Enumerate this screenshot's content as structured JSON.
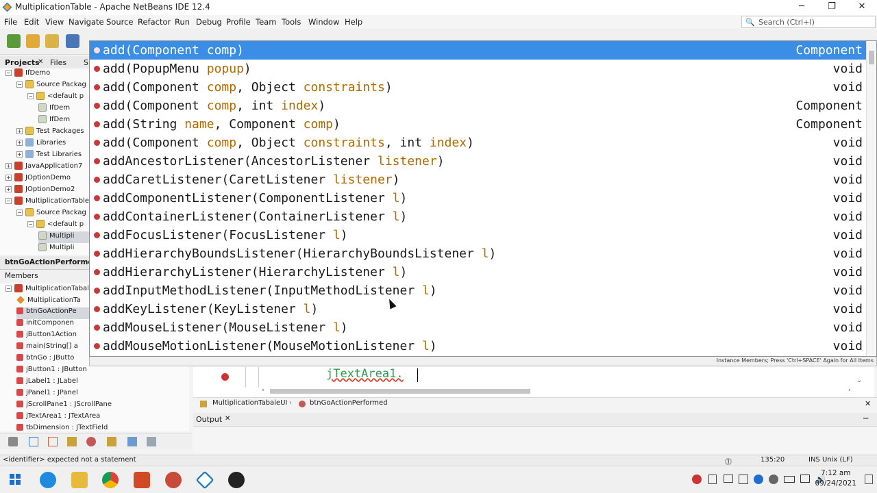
{
  "window": {
    "title": "MultiplicationTable - Apache NetBeans IDE 12.4"
  },
  "menus": [
    "File",
    "Edit",
    "View",
    "Navigate",
    "Source",
    "Refactor",
    "Run",
    "Debug",
    "Profile",
    "Team",
    "Tools",
    "Window",
    "Help"
  ],
  "search": {
    "placeholder": "Search (Ctrl+I)"
  },
  "projects_panel": {
    "tabs": [
      "Projects",
      "Files",
      "S"
    ],
    "tree": [
      {
        "label": "IfDemo",
        "indent": 0,
        "icon": "cup",
        "expanded": true
      },
      {
        "label": "Source Packag",
        "indent": 1,
        "icon": "pkg",
        "expanded": true
      },
      {
        "label": "<default p",
        "indent": 2,
        "icon": "pkg",
        "expanded": true
      },
      {
        "label": "IfDem",
        "indent": 3,
        "icon": "jav"
      },
      {
        "label": "IfDem",
        "indent": 3,
        "icon": "jav"
      },
      {
        "label": "Test Packages",
        "indent": 1,
        "icon": "pkg",
        "expanded": false
      },
      {
        "label": "Libraries",
        "indent": 1,
        "icon": "fold",
        "expanded": false
      },
      {
        "label": "Test Libraries",
        "indent": 1,
        "icon": "fold",
        "expanded": false
      },
      {
        "label": "JavaApplication7",
        "indent": 0,
        "icon": "cup",
        "expanded": false
      },
      {
        "label": "JOptionDemo",
        "indent": 0,
        "icon": "cup",
        "expanded": false
      },
      {
        "label": "JOptionDemo2",
        "indent": 0,
        "icon": "cup",
        "expanded": false
      },
      {
        "label": "MultiplicationTable",
        "indent": 0,
        "icon": "cup",
        "expanded": true
      },
      {
        "label": "Source Packag",
        "indent": 1,
        "icon": "pkg",
        "expanded": true
      },
      {
        "label": "<default p",
        "indent": 2,
        "icon": "pkg",
        "expanded": true
      },
      {
        "label": "Multipli",
        "indent": 3,
        "icon": "jav",
        "selected": true
      },
      {
        "label": "Multipli",
        "indent": 3,
        "icon": "jav"
      }
    ]
  },
  "navigator": {
    "title": "btnGoActionPerformed",
    "filter": "Members",
    "items": [
      {
        "label": "MultiplicationTabale",
        "indent": 0,
        "icon": "cup",
        "expanded": true
      },
      {
        "label": "MultiplicationTa",
        "indent": 1,
        "icon": "f"
      },
      {
        "label": "btnGoActionPe",
        "indent": 1,
        "icon": "m",
        "selected": true
      },
      {
        "label": "initComponen",
        "indent": 1,
        "icon": "m"
      },
      {
        "label": "jButton1Action",
        "indent": 1,
        "icon": "m"
      },
      {
        "label": "main(String[] a",
        "indent": 1,
        "icon": "m"
      },
      {
        "label": "btnGo : JButto",
        "indent": 1,
        "icon": "m"
      },
      {
        "label": "jButton1 : JButton",
        "indent": 1,
        "icon": "m"
      },
      {
        "label": "jLabel1 : JLabel",
        "indent": 1,
        "icon": "m"
      },
      {
        "label": "jPanel1 : JPanel",
        "indent": 1,
        "icon": "m"
      },
      {
        "label": "jScrollPane1 : JScrollPane",
        "indent": 1,
        "icon": "m"
      },
      {
        "label": "jTextArea1 : JTextArea",
        "indent": 1,
        "icon": "m"
      },
      {
        "label": "tbDimension : JTextField",
        "indent": 1,
        "icon": "m"
      }
    ]
  },
  "completion": {
    "items": [
      {
        "name": "add(",
        "params": [
          [
            "Component ",
            "comp"
          ]
        ],
        "close": ")",
        "ret": "Component"
      },
      {
        "name": "add(",
        "params": [
          [
            "PopupMenu ",
            "popup"
          ]
        ],
        "close": ")",
        "ret": "void"
      },
      {
        "name": "add(",
        "params": [
          [
            "Component ",
            "comp"
          ],
          [
            "Object ",
            "constraints"
          ]
        ],
        "close": ")",
        "ret": "void"
      },
      {
        "name": "add(",
        "params": [
          [
            "Component ",
            "comp"
          ],
          [
            "int ",
            "index"
          ]
        ],
        "close": ")",
        "ret": "Component"
      },
      {
        "name": "add(",
        "params": [
          [
            "String ",
            "name"
          ],
          [
            "Component ",
            "comp"
          ]
        ],
        "close": ")",
        "ret": "Component"
      },
      {
        "name": "add(",
        "params": [
          [
            "Component ",
            "comp"
          ],
          [
            "Object ",
            "constraints"
          ],
          [
            "int ",
            "index"
          ]
        ],
        "close": ")",
        "ret": "void"
      },
      {
        "name": "addAncestorListener(",
        "params": [
          [
            "AncestorListener ",
            "listener"
          ]
        ],
        "close": ")",
        "ret": "void"
      },
      {
        "name": "addCaretListener(",
        "params": [
          [
            "CaretListener ",
            "listener"
          ]
        ],
        "close": ")",
        "ret": "void"
      },
      {
        "name": "addComponentListener(",
        "params": [
          [
            "ComponentListener ",
            "l"
          ]
        ],
        "close": ")",
        "ret": "void"
      },
      {
        "name": "addContainerListener(",
        "params": [
          [
            "ContainerListener ",
            "l"
          ]
        ],
        "close": ")",
        "ret": "void"
      },
      {
        "name": "addFocusListener(",
        "params": [
          [
            "FocusListener ",
            "l"
          ]
        ],
        "close": ")",
        "ret": "void"
      },
      {
        "name": "addHierarchyBoundsListener(",
        "params": [
          [
            "HierarchyBoundsListener ",
            "l"
          ]
        ],
        "close": ")",
        "ret": "void"
      },
      {
        "name": "addHierarchyListener(",
        "params": [
          [
            "HierarchyListener ",
            "l"
          ]
        ],
        "close": ")",
        "ret": "void"
      },
      {
        "name": "addInputMethodListener(",
        "params": [
          [
            "InputMethodListener ",
            "l"
          ]
        ],
        "close": ")",
        "ret": "void"
      },
      {
        "name": "addKeyListener(",
        "params": [
          [
            "KeyListener ",
            "l"
          ]
        ],
        "close": ")",
        "ret": "void"
      },
      {
        "name": "addMouseListener(",
        "params": [
          [
            "MouseListener ",
            "l"
          ]
        ],
        "close": ")",
        "ret": "void"
      },
      {
        "name": "addMouseMotionListener(",
        "params": [
          [
            "MouseMotionListener ",
            "l"
          ]
        ],
        "close": ")",
        "ret": "void"
      }
    ],
    "hint": "Instance Members; Press 'Ctrl+SPACE' Again for All Items",
    "highlight_color": "#3a8ee6"
  },
  "editor": {
    "code": "jTextArea1."
  },
  "breadcrumbs": [
    "MultiplicationTabaleUI",
    "btnGoActionPerformed"
  ],
  "output": {
    "tab": "Output"
  },
  "status": {
    "message": "<identifier> expected  not a statement",
    "position": "135:20",
    "mode": "INS Unix (LF)"
  },
  "clock": {
    "time": "7:12 am",
    "date": "09/24/2021"
  }
}
